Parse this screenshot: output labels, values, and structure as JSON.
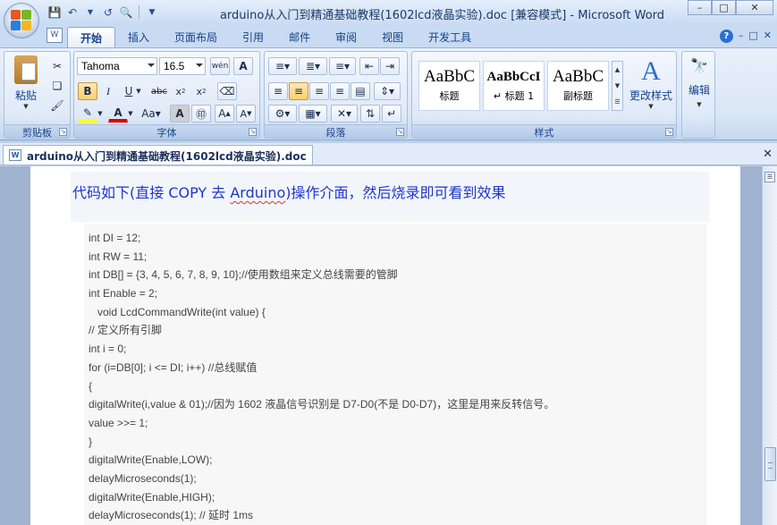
{
  "window": {
    "title": "arduino从入门到精通基础教程(1602lcd液晶实验).doc [兼容模式] - Microsoft Word"
  },
  "tabs": [
    "开始",
    "插入",
    "页面布局",
    "引用",
    "邮件",
    "审阅",
    "视图",
    "开发工具"
  ],
  "ribbon": {
    "clipboard": {
      "label": "剪贴板",
      "paste_label": "粘贴"
    },
    "font": {
      "label": "字体",
      "font_name": "Tahoma",
      "font_size": "16.5"
    },
    "paragraph": {
      "label": "段落"
    },
    "styles": {
      "label": "样式",
      "items": [
        {
          "sample": "AaBbC",
          "name": "标题"
        },
        {
          "sample": "AaBbCcI",
          "name": "↵ 标题 1"
        },
        {
          "sample": "AaBbC",
          "name": "副标题"
        }
      ],
      "change_styles_label": "更改样式"
    },
    "editing": {
      "label": "编辑"
    }
  },
  "document": {
    "tab_title": "arduino从入门到精通基础教程(1602lcd液晶实验).doc",
    "heading_parts": [
      "代码如下(直接 COPY 去 ",
      "Arduino",
      ")操作介面，然后烧录即可看到效果"
    ],
    "code_lines": [
      "int DI = 12;",
      "int RW = 11;",
      "int DB[] = {3, 4, 5, 6, 7, 8, 9, 10};//使用数组来定义总线需要的管脚",
      "int Enable = 2;",
      "   void LcdCommandWrite(int value) {",
      "// 定义所有引脚",
      "int i = 0;",
      "for (i=DB[0]; i <= DI; i++) //总线赋值",
      "{",
      "digitalWrite(i,value & 01);//因为 1602 液晶信号识别是 D7-D0(不是 D0-D7)，这里是用来反转信号。",
      "value >>= 1;",
      "}",
      "digitalWrite(Enable,LOW);",
      "delayMicroseconds(1);",
      "digitalWrite(Enable,HIGH);",
      "delayMicroseconds(1); // 延时 1ms"
    ]
  }
}
